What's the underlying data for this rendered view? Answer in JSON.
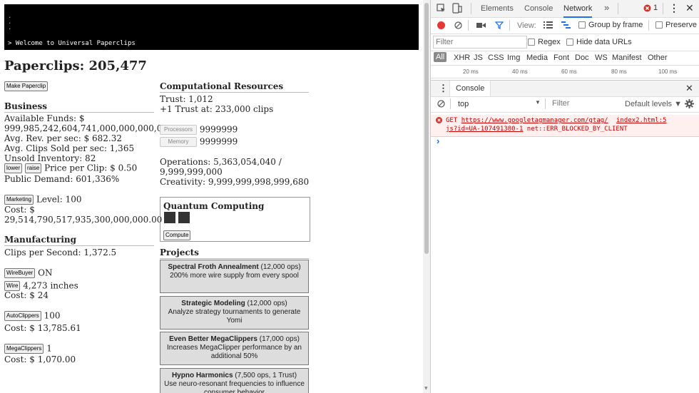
{
  "game": {
    "console_lines": [
      ".",
      ".",
      "."
    ],
    "console_message": "> Welcome to Universal Paperclips",
    "paperclips_label": "Paperclips: 205,477",
    "make_paperclip": "Make Paperclip",
    "business": {
      "header": "Business",
      "available_funds_label": "Available Funds: $",
      "available_funds": "999,985,242,604,741,000,000,000,000.00",
      "avg_rev": "Avg. Rev. per sec: $ 682.32",
      "avg_clips_sold": "Avg. Clips Sold per sec: 1,365",
      "unsold_inventory": "Unsold Inventory: 82",
      "lower": "lower",
      "raise": "raise",
      "price_per_clip": "Price per Clip: $ 0.50",
      "public_demand": "Public Demand: 601,336%",
      "marketing": "Marketing",
      "marketing_level": "Level: 100",
      "marketing_cost_label": "Cost: $",
      "marketing_cost": "29,514,790,517,935,300,000,000.00"
    },
    "manufacturing": {
      "header": "Manufacturing",
      "clips_per_second": "Clips per Second: 1,372.5",
      "wirebuyer": "WireBuyer",
      "wirebuyer_status": "ON",
      "wire": "Wire",
      "wire_amount": "4,273 inches",
      "wire_cost": "Cost: $ 24",
      "autoclippers": "AutoClippers",
      "autoclippers_count": "100",
      "autoclippers_cost": "Cost: $ 13,785.61",
      "megaclippers": "MegaClippers",
      "megaclippers_count": "1",
      "megaclippers_cost": "Cost: $ 1,070.00"
    },
    "computational": {
      "header": "Computational Resources",
      "trust": "Trust: 1,012",
      "next_trust": "+1 Trust at: 233,000 clips",
      "processors": "Processors",
      "processors_value": "9999999",
      "memory": "Memory",
      "memory_value": "9999999",
      "operations_line1": "Operations: 5,363,054,040 /",
      "operations_line2": "9,999,999,000",
      "creativity": "Creativity: 9,999,999,998,999,680"
    },
    "quantum": {
      "header": "Quantum Computing",
      "compute": "Compute"
    },
    "projects": {
      "header": "Projects",
      "items": [
        {
          "title": "Spectral Froth Annealment",
          "cost": " (12,000 ops)",
          "desc": "200% more wire supply from every spool"
        },
        {
          "title": "Strategic Modeling",
          "cost": " (12,000 ops)",
          "desc": "Analyze strategy tournaments to generate Yomi"
        },
        {
          "title": "Even Better MegaClippers",
          "cost": " (17,000 ops)",
          "desc": "Increases MegaClipper performance by an additional 50%"
        },
        {
          "title": "Hypno Harmonics",
          "cost": " (7,500 ops, 1 Trust)",
          "desc": "Use neuro-resonant frequencies to influence consumer behavior"
        }
      ]
    }
  },
  "devtools": {
    "tabs": [
      "Elements",
      "Console",
      "Network"
    ],
    "active_tab": "Network",
    "more": "»",
    "error_count": "1",
    "view_label": "View:",
    "group_by_frame": "Group by frame",
    "preserve": "Preserve",
    "filter_placeholder": "Filter",
    "regex": "Regex",
    "hide_data_urls": "Hide data URLs",
    "types": [
      "All",
      "XHR",
      "JS",
      "CSS",
      "Img",
      "Media",
      "Font",
      "Doc",
      "WS",
      "Manifest",
      "Other"
    ],
    "timeline_ticks": [
      "20 ms",
      "40 ms",
      "60 ms",
      "80 ms",
      "100 ms"
    ],
    "drawer_tab": "Console",
    "context": "top",
    "console_filter_placeholder": "Filter",
    "levels": "Default levels ▼",
    "error": {
      "method": "GET",
      "url": "https://www.googletagmanager.com/gtag/",
      "source": "index2.html:5",
      "url2": "js?id=UA-107491380-1",
      "message": "net::ERR_BLOCKED_BY_CLIENT"
    },
    "prompt": "›"
  },
  "colors": {
    "accent": "#1a73e8",
    "error": "#d93025",
    "record": "#e53935"
  }
}
